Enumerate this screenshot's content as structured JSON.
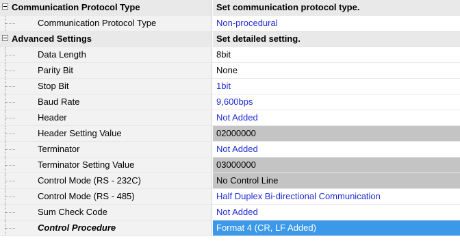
{
  "grid": {
    "categories": [
      {
        "label": "Communication Protocol Type",
        "value": "Set communication protocol type.",
        "expander": "−",
        "items": [
          {
            "label": "Communication Protocol Type",
            "value": "Non-procedural",
            "value_color": "#1e2bd6"
          }
        ]
      },
      {
        "label": "Advanced Settings",
        "value": "Set detailed setting.",
        "expander": "−",
        "items": [
          {
            "label": "Data Length",
            "value": "8bit"
          },
          {
            "label": "Parity Bit",
            "value": "None"
          },
          {
            "label": "Stop Bit",
            "value": "1bit",
            "value_color": "#1e2bd6"
          },
          {
            "label": "Baud Rate",
            "value": "9,600bps",
            "value_color": "#1e2bd6"
          },
          {
            "label": "Header",
            "value": "Not Added",
            "value_color": "#1e2bd6"
          },
          {
            "label": "Header Setting Value",
            "value": "02000000",
            "disabled": true
          },
          {
            "label": "Terminator",
            "value": "Not Added",
            "value_color": "#1e2bd6"
          },
          {
            "label": "Terminator Setting Value",
            "value": "03000000",
            "disabled": true
          },
          {
            "label": "Control Mode (RS - 232C)",
            "value": "No Control Line",
            "disabled": true
          },
          {
            "label": "Control Mode (RS - 485)",
            "value": "Half Duplex Bi-directional Communication",
            "value_color": "#1e2bd6"
          },
          {
            "label": "Sum Check Code",
            "value": "Not Added",
            "value_color": "#1e2bd6"
          },
          {
            "label": "Control Procedure",
            "value": "Format 4 (CR, LF Added)",
            "selected": true
          }
        ]
      }
    ]
  }
}
